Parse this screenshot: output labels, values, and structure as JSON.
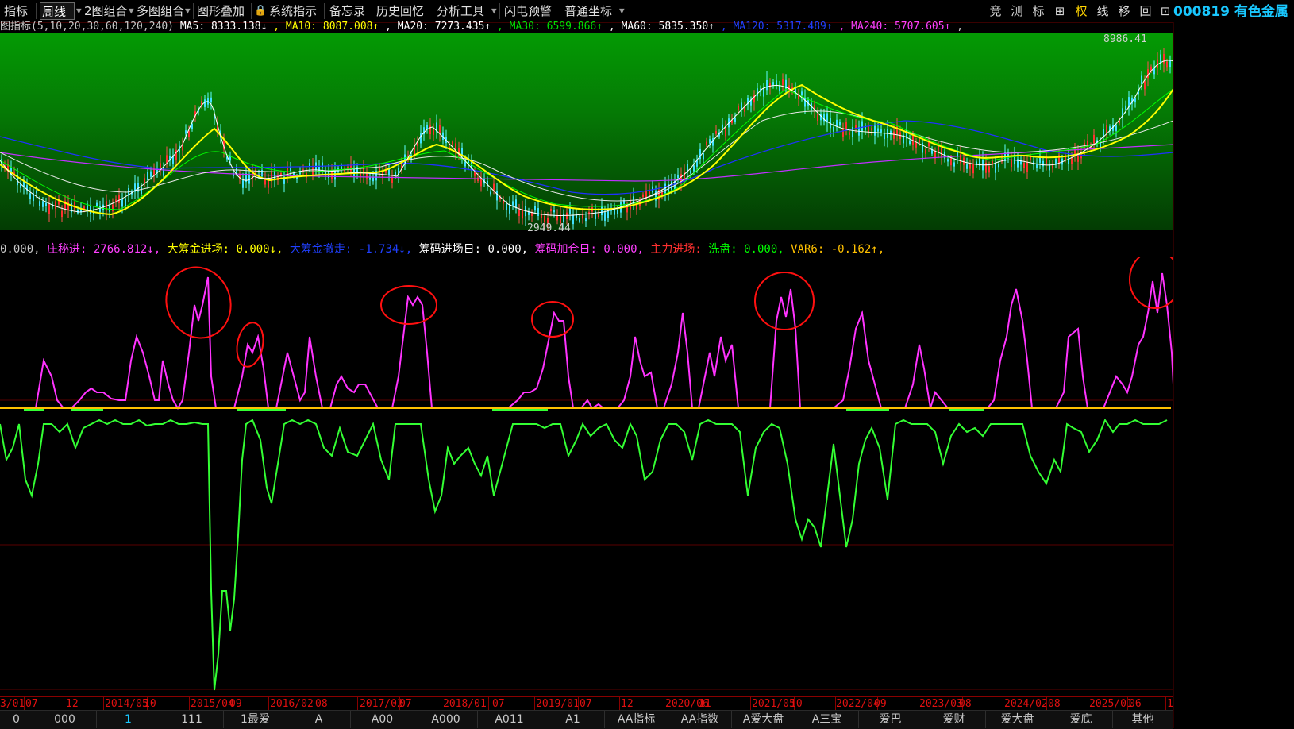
{
  "toolbar": {
    "items": [
      "指标",
      "周线",
      "2图组合",
      "多图组合",
      "图形叠加",
      "系统指示",
      "备忘录",
      "历史回忆",
      "分析工具",
      "闪电预警",
      "普通坐标"
    ],
    "selected": "周线",
    "right_items": [
      "竞",
      "测",
      "标",
      "⊞",
      "权",
      "线",
      "移",
      "回",
      "⊡"
    ],
    "active_right": "权",
    "stock_title": "000819 有色金属"
  },
  "main_chart": {
    "legend": [
      {
        "text": "图指标(5,10,20,30,60,120,240)",
        "color": "#c8c8c8"
      },
      {
        "text": "MA5: 8333.138↓",
        "color": "#ffffff"
      },
      {
        "text": ", MA10: 8087.008↑",
        "color": "#ffff00"
      },
      {
        "text": ", MA20: 7273.435↑",
        "color": "#ffffff"
      },
      {
        "text": ", MA30: 6599.866↑",
        "color": "#00e000"
      },
      {
        "text": ", MA60: 5835.350↑",
        "color": "#ffffff"
      },
      {
        "text": ", MA120: 5317.489↑",
        "color": "#2040ff"
      },
      {
        "text": ", MA240: 5707.605↑",
        "color": "#ff40ff"
      },
      {
        "text": ",",
        "color": "#c8c8c8"
      }
    ],
    "high_label": "8986.41",
    "low_label": "2949.44",
    "colors": {
      "bg_top": "#049a04",
      "bg_bottom": "#033c03",
      "ma5": "#ffffff",
      "ma10": "#ffff00",
      "ma20": "#ffffff",
      "ma30": "#00ff00",
      "ma120": "#2030ff",
      "ma240": "#c030ff"
    }
  },
  "indicator": {
    "legend": [
      {
        "text": "0.000,",
        "color": "#c8c8c8"
      },
      {
        "text": " 庄秘进: 2766.812↓,",
        "color": "#ff40ff"
      },
      {
        "text": " 大筹金进场: 0.000↓,",
        "color": "#ffff00"
      },
      {
        "text": " 大筹金撤走: -1.734↓,",
        "color": "#2040ff"
      },
      {
        "text": " 筹码进场日: 0.000,",
        "color": "#ffffff"
      },
      {
        "text": " 筹码加仓日: 0.000,",
        "color": "#ff40ff"
      },
      {
        "text": " 主力进场:",
        "color": "#ff3030"
      },
      {
        "text": " 洗盘: 0.000,",
        "color": "#00ff00"
      },
      {
        "text": " VAR6: -0.162↑,",
        "color": "#ffc000"
      }
    ]
  },
  "date_axis": [
    "3/01",
    "07",
    "12",
    "2014/05",
    "10",
    "2015/04",
    "09",
    "2016/02",
    "08",
    "2017/02",
    "07",
    "2018/01",
    "07",
    "2019/01",
    "07",
    "12",
    "2020/06",
    "11",
    "2021/05",
    "10",
    "2022/04",
    "09",
    "2023/03",
    "08",
    "2024/02",
    "08",
    "2025/01",
    "06",
    "1"
  ],
  "tabs": [
    "0",
    "000",
    "1",
    "111",
    "1最爱",
    "A",
    "A00",
    "A000",
    "A011",
    "A1",
    "AA指标",
    "AA指数",
    "A爱大盘",
    "A三宝",
    "爱巴",
    "爱财",
    "爱大盘",
    "爱底",
    "其他"
  ],
  "highlight_tab": "1"
}
